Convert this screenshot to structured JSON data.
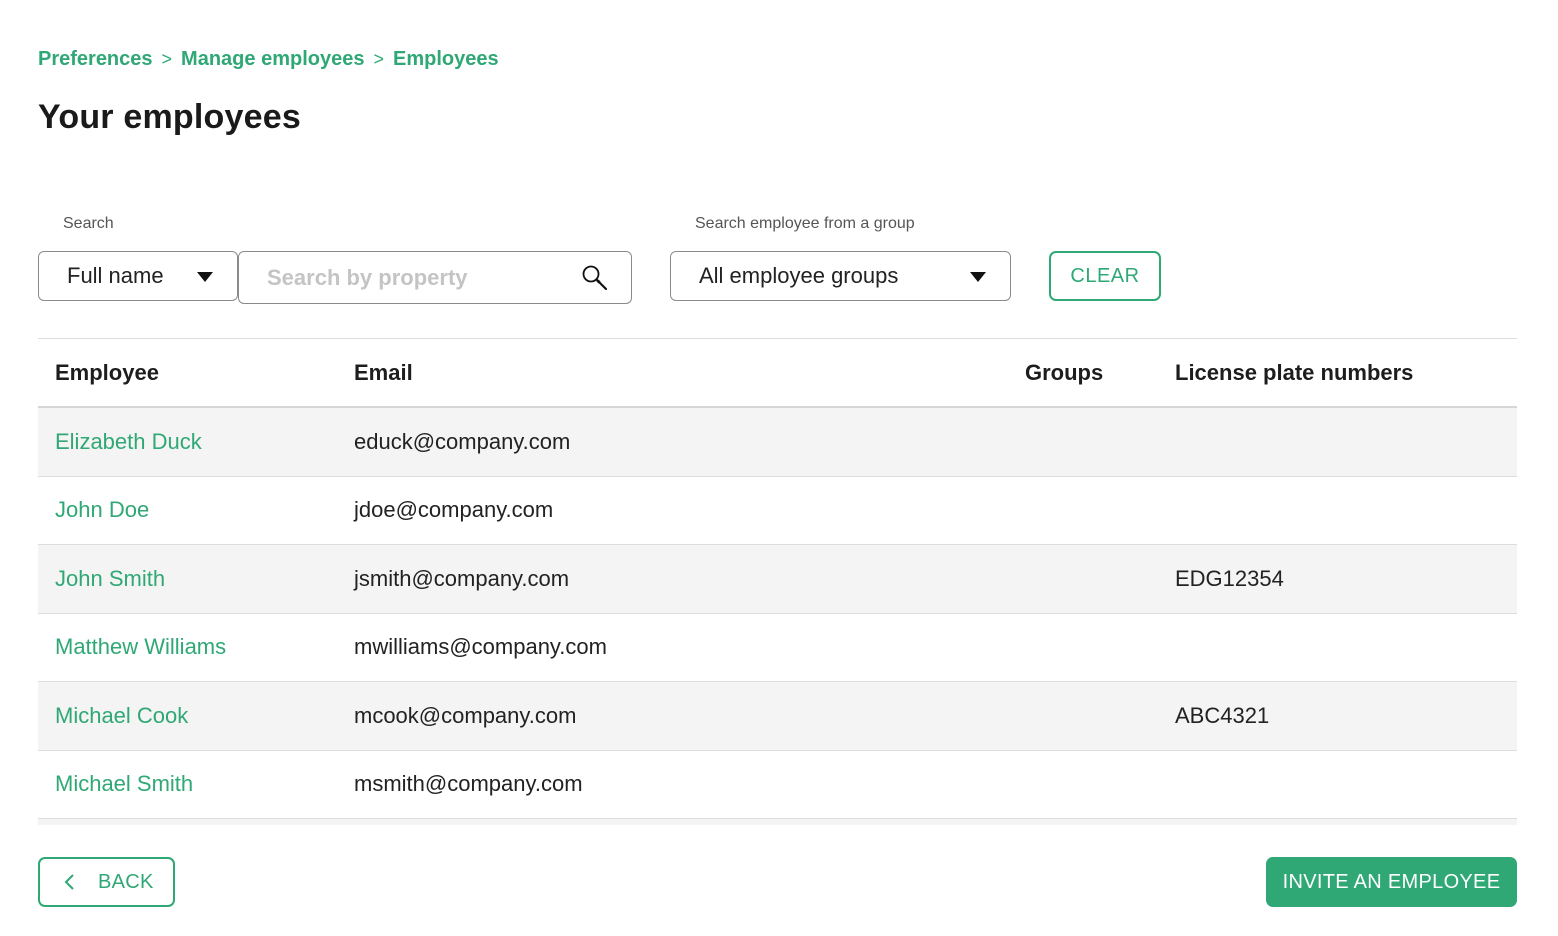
{
  "colors": {
    "accent": "#2fa876",
    "row_alt": "#f4f4f4"
  },
  "breadcrumb": [
    "Preferences",
    "Manage employees",
    "Employees"
  ],
  "breadcrumb_separator": ">",
  "page_title": "Your employees",
  "filters": {
    "search_label": "Search",
    "property_select_value": "Full name",
    "search_placeholder": "Search by property",
    "search_icon": "search-icon",
    "group_label": "Search employee from a group",
    "group_select_value": "All employee groups",
    "clear_label": "CLEAR"
  },
  "table": {
    "columns": [
      "Employee",
      "Email",
      "Groups",
      "License plate numbers"
    ],
    "rows": [
      {
        "name": "Elizabeth Duck",
        "email": "educk@company.com",
        "groups": "",
        "plate": ""
      },
      {
        "name": "John Doe",
        "email": "jdoe@company.com",
        "groups": "",
        "plate": ""
      },
      {
        "name": "John Smith",
        "email": "jsmith@company.com",
        "groups": "",
        "plate": "EDG12354"
      },
      {
        "name": "Matthew Williams",
        "email": "mwilliams@company.com",
        "groups": "",
        "plate": ""
      },
      {
        "name": "Michael Cook",
        "email": "mcook@company.com",
        "groups": "",
        "plate": "ABC4321"
      },
      {
        "name": "Michael Smith",
        "email": "msmith@company.com",
        "groups": "",
        "plate": ""
      }
    ]
  },
  "footer": {
    "back_label": "BACK",
    "back_icon": "chevron-left-icon",
    "invite_label": "INVITE AN EMPLOYEE"
  }
}
